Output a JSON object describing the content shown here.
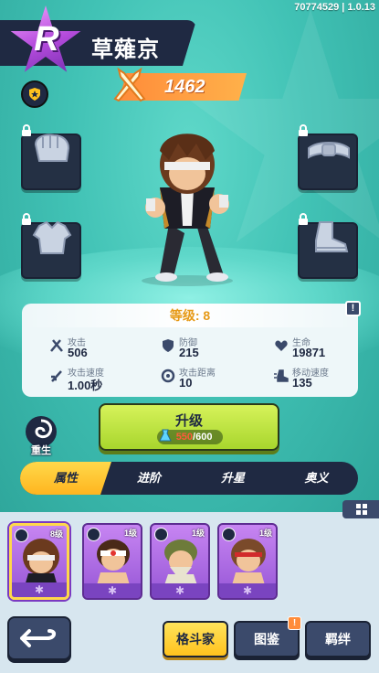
{
  "header": {
    "version": "70774529 | 1.0.13",
    "rank_letter": "R",
    "fighter_name": "草薙京",
    "power": "1462"
  },
  "equipment": [
    {
      "slot": "gloves",
      "locked": true
    },
    {
      "slot": "belt",
      "locked": true
    },
    {
      "slot": "armor",
      "locked": true
    },
    {
      "slot": "boots",
      "locked": true
    }
  ],
  "stats": {
    "level_label": "等级: 8",
    "info": "!",
    "items": [
      {
        "key": "attack",
        "label": "攻击",
        "value": "506"
      },
      {
        "key": "defense",
        "label": "防御",
        "value": "215"
      },
      {
        "key": "hp",
        "label": "生命",
        "value": "19871"
      },
      {
        "key": "attack_speed",
        "label": "攻击速度",
        "value": "1.00秒"
      },
      {
        "key": "attack_range",
        "label": "攻击距离",
        "value": "10"
      },
      {
        "key": "move_speed",
        "label": "移动速度",
        "value": "135"
      }
    ]
  },
  "rebirth_label": "重生",
  "upgrade": {
    "label": "升级",
    "cost_have": "550",
    "cost_sep_need": "/600"
  },
  "tabs": [
    {
      "label": "属性",
      "active": true
    },
    {
      "label": "进阶",
      "active": false
    },
    {
      "label": "升星",
      "active": false
    },
    {
      "label": "奥义",
      "active": false
    }
  ],
  "roster": [
    {
      "level": "8级",
      "selected": true
    },
    {
      "level": "1级",
      "selected": false
    },
    {
      "level": "1级",
      "selected": false
    },
    {
      "level": "1级",
      "selected": false
    }
  ],
  "bottom_nav": {
    "fighters": "格斗家",
    "codex": "图鉴",
    "codex_badge": "!",
    "bonds": "羁绊"
  },
  "colors": {
    "accent_yellow": "#ffc21e",
    "panel_dark": "#1f2942",
    "teal_bg": "#41c2b5",
    "rank_purple": "#b44bdc"
  }
}
